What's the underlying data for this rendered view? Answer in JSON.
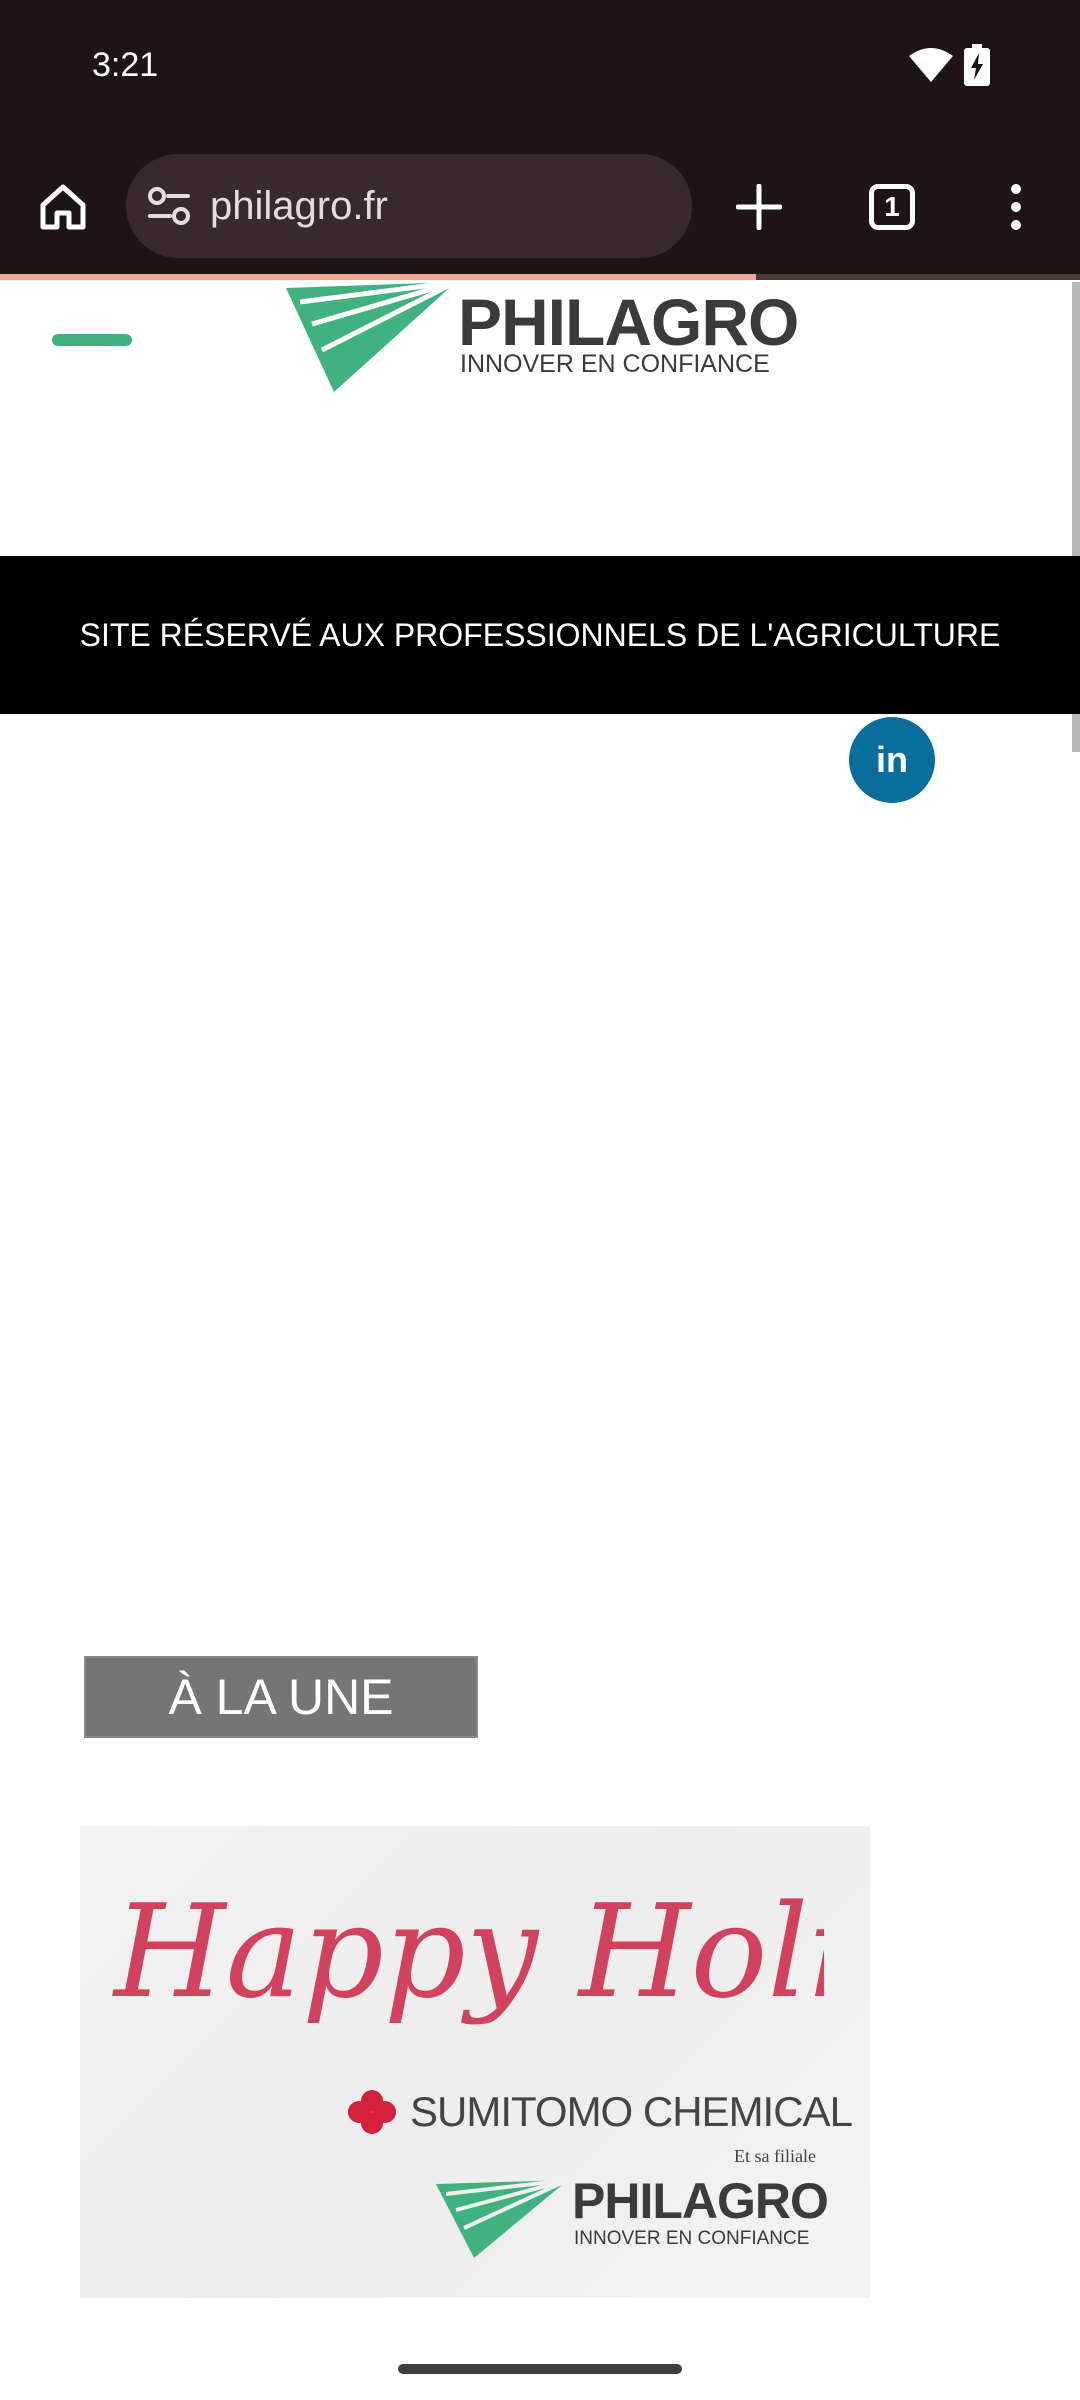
{
  "status_bar": {
    "time": "3:21",
    "icons": [
      "wifi-icon",
      "battery-charging-icon"
    ]
  },
  "browser": {
    "url": "philagro.fr",
    "tab_count": "1",
    "load_progress": 0.7,
    "progress_color": "#f3a694"
  },
  "header": {
    "logo_name": "PHILAGRO",
    "logo_tagline": "INNOVER EN CONFIANCE",
    "menu_color": "#3fb27f",
    "brand_green": "#3fb27f"
  },
  "banner": {
    "text": "SITE RÉSERVÉ AUX PROFESSIONNELS DE L'AGRICULTURE"
  },
  "social": {
    "linkedin": "in",
    "linkedin_color": "#0a6e9c"
  },
  "headline": {
    "label": "À LA UNE"
  },
  "holiday_card": {
    "greeting": "Happy Holiday",
    "company": "SUMITOMO CHEMICAL",
    "subsidiary": "Et sa filiale",
    "logo_name": "PHILAGRO",
    "logo_tagline": "INNOVER EN CONFIANCE",
    "greeting_color": "#d2415e"
  }
}
